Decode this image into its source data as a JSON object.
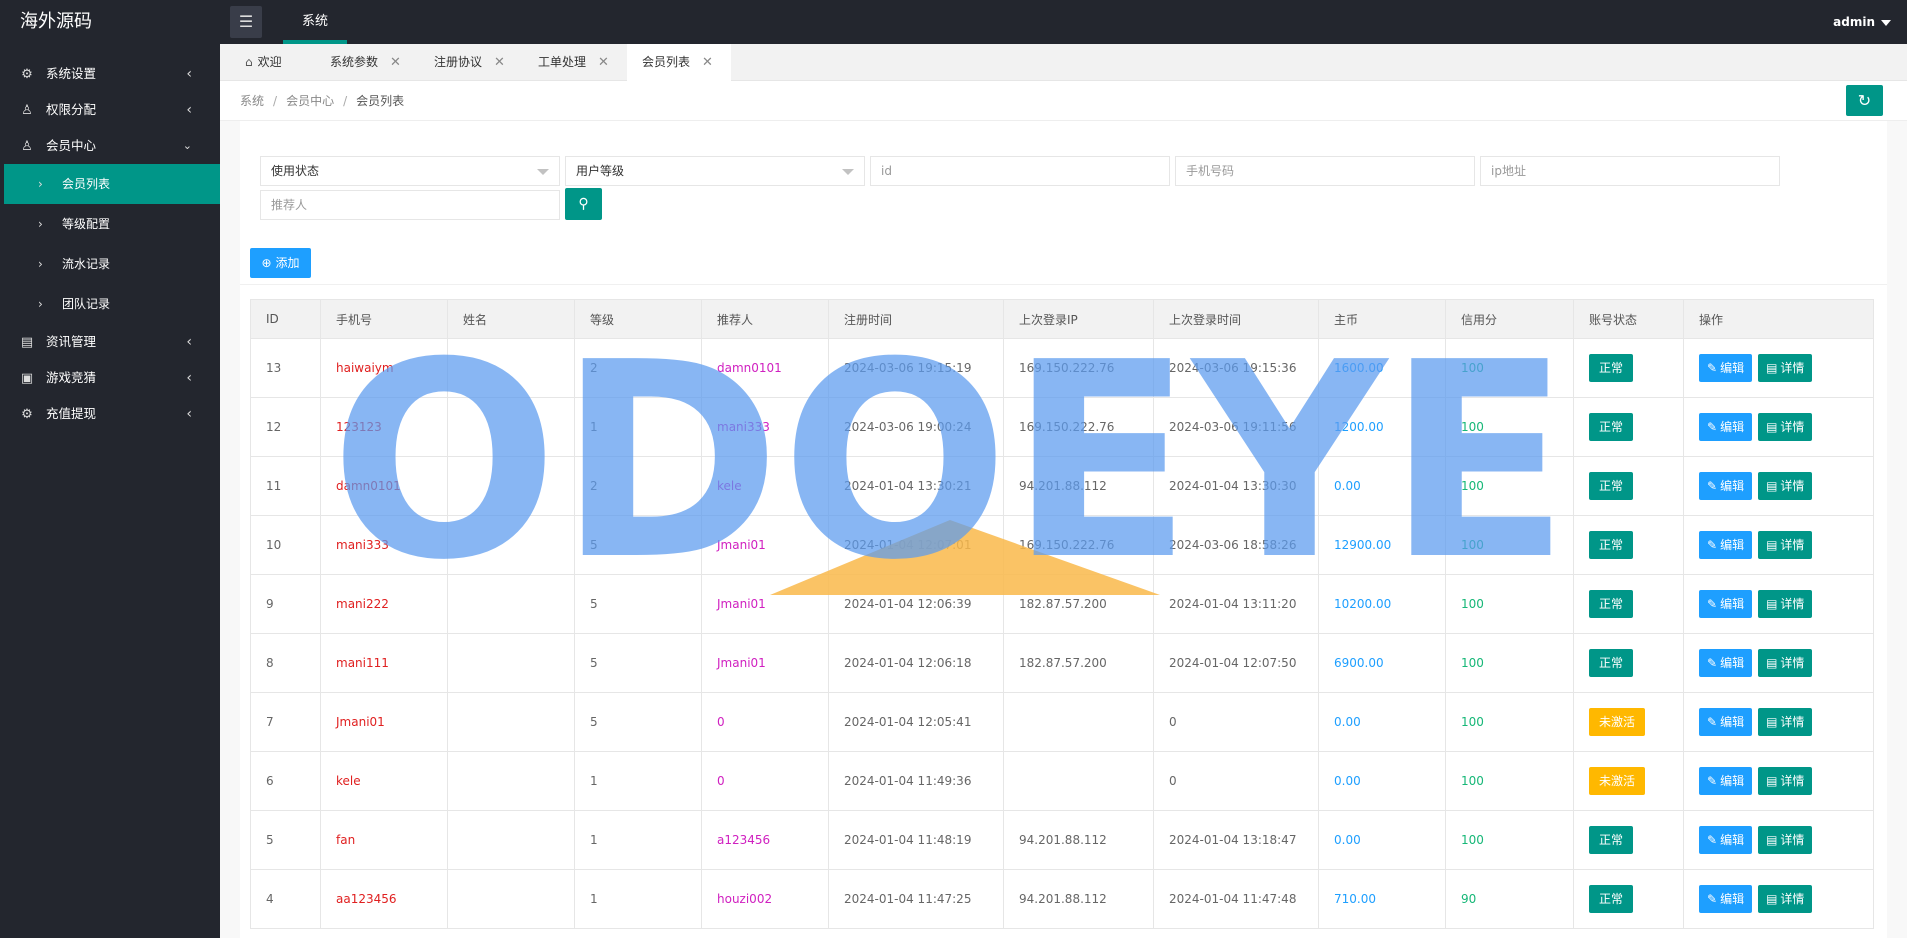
{
  "app": {
    "title": "海外源码"
  },
  "topnav": {
    "label": "系统"
  },
  "user": {
    "name": "admin"
  },
  "sidebar": {
    "items": [
      {
        "label": "系统设置",
        "icon": "gear-icon"
      },
      {
        "label": "权限分配",
        "icon": "user-check-icon"
      },
      {
        "label": "会员中心",
        "icon": "user-icon"
      },
      {
        "label": "资讯管理",
        "icon": "news-icon"
      },
      {
        "label": "游戏竞猜",
        "icon": "monitor-icon"
      },
      {
        "label": "充值提现",
        "icon": "gear-icon"
      }
    ],
    "subitems": [
      {
        "label": "会员列表"
      },
      {
        "label": "等级配置"
      },
      {
        "label": "流水记录"
      },
      {
        "label": "团队记录"
      }
    ]
  },
  "tabs": [
    {
      "label": "欢迎"
    },
    {
      "label": "系统参数"
    },
    {
      "label": "注册协议"
    },
    {
      "label": "工单处理"
    },
    {
      "label": "会员列表"
    }
  ],
  "breadcrumb": [
    "系统",
    "会员中心",
    "会员列表"
  ],
  "filters": {
    "status_select": "使用状态",
    "level_select": "用户等级",
    "id_placeholder": "id",
    "phone_placeholder": "手机号码",
    "ip_placeholder": "ip地址",
    "referrer_placeholder": "推荐人"
  },
  "toolbar": {
    "add_label": "添加"
  },
  "table": {
    "headers": [
      "ID",
      "手机号",
      "姓名",
      "等级",
      "推荐人",
      "注册时间",
      "上次登录IP",
      "上次登录时间",
      "主币",
      "信用分",
      "账号状态",
      "操作"
    ],
    "edit_label": "编辑",
    "detail_label": "详情",
    "rows": [
      {
        "id": "13",
        "phone": "haiwaiym",
        "name": "",
        "level": "2",
        "referrer": "damn0101",
        "reg_time": "2024-03-06 19:15:19",
        "last_ip": "169.150.222.76",
        "last_time": "2024-03-06 19:15:36",
        "coin": "1600.00",
        "credit": "100",
        "status": "正常",
        "status_type": "ok"
      },
      {
        "id": "12",
        "phone": "123123",
        "name": "",
        "level": "1",
        "referrer": "mani333",
        "reg_time": "2024-03-06 19:00:24",
        "last_ip": "169.150.222.76",
        "last_time": "2024-03-06 19:11:56",
        "coin": "1200.00",
        "credit": "100",
        "status": "正常",
        "status_type": "ok"
      },
      {
        "id": "11",
        "phone": "damn0101",
        "name": "",
        "level": "2",
        "referrer": "kele",
        "reg_time": "2024-01-04 13:30:21",
        "last_ip": "94.201.88.112",
        "last_time": "2024-01-04 13:30:30",
        "coin": "0.00",
        "credit": "100",
        "status": "正常",
        "status_type": "ok"
      },
      {
        "id": "10",
        "phone": "mani333",
        "name": "",
        "level": "5",
        "referrer": "Jmani01",
        "reg_time": "2024-01-04 12:07:01",
        "last_ip": "169.150.222.76",
        "last_time": "2024-03-06 18:58:26",
        "coin": "12900.00",
        "credit": "100",
        "status": "正常",
        "status_type": "ok"
      },
      {
        "id": "9",
        "phone": "mani222",
        "name": "",
        "level": "5",
        "referrer": "Jmani01",
        "reg_time": "2024-01-04 12:06:39",
        "last_ip": "182.87.57.200",
        "last_time": "2024-01-04 13:11:20",
        "coin": "10200.00",
        "credit": "100",
        "status": "正常",
        "status_type": "ok"
      },
      {
        "id": "8",
        "phone": "mani111",
        "name": "",
        "level": "5",
        "referrer": "Jmani01",
        "reg_time": "2024-01-04 12:06:18",
        "last_ip": "182.87.57.200",
        "last_time": "2024-01-04 12:07:50",
        "coin": "6900.00",
        "credit": "100",
        "status": "正常",
        "status_type": "ok"
      },
      {
        "id": "7",
        "phone": "Jmani01",
        "name": "",
        "level": "5",
        "referrer": "0",
        "reg_time": "2024-01-04 12:05:41",
        "last_ip": "",
        "last_time": "0",
        "coin": "0.00",
        "credit": "100",
        "status": "未激活",
        "status_type": "warn"
      },
      {
        "id": "6",
        "phone": "kele",
        "name": "",
        "level": "1",
        "referrer": "0",
        "reg_time": "2024-01-04 11:49:36",
        "last_ip": "",
        "last_time": "0",
        "coin": "0.00",
        "credit": "100",
        "status": "未激活",
        "status_type": "warn"
      },
      {
        "id": "5",
        "phone": "fan",
        "name": "",
        "level": "1",
        "referrer": "a123456",
        "reg_time": "2024-01-04 11:48:19",
        "last_ip": "94.201.88.112",
        "last_time": "2024-01-04 13:18:47",
        "coin": "0.00",
        "credit": "100",
        "status": "正常",
        "status_type": "ok"
      },
      {
        "id": "4",
        "phone": "aa123456",
        "name": "",
        "level": "1",
        "referrer": "houzi002",
        "reg_time": "2024-01-04 11:47:25",
        "last_ip": "94.201.88.112",
        "last_time": "2024-01-04 11:47:48",
        "coin": "710.00",
        "credit": "90",
        "status": "正常",
        "status_type": "ok"
      }
    ]
  },
  "watermark": {
    "text": "ODOEYE"
  },
  "colors": {
    "primary": "#009688",
    "blue": "#1e9fff",
    "warn": "#ffb800",
    "sidebar": "#23262e"
  }
}
